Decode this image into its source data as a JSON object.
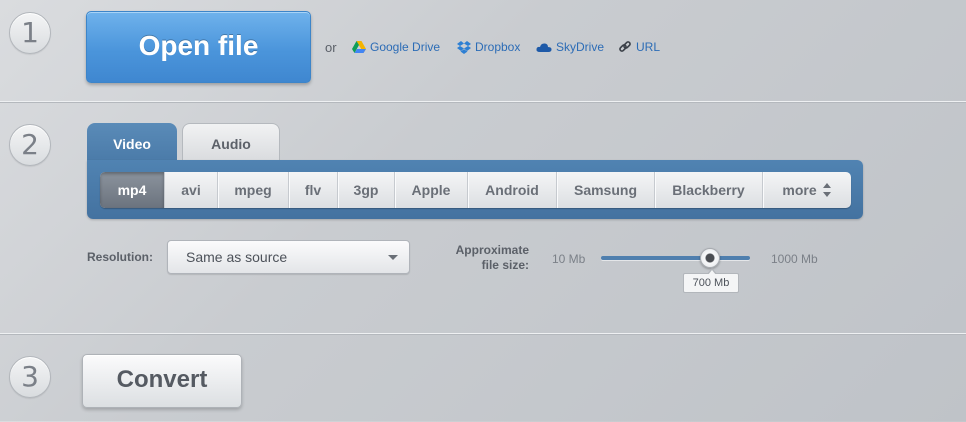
{
  "steps": [
    "1",
    "2",
    "3"
  ],
  "open_file": {
    "label": "Open file",
    "or_text": "or"
  },
  "sources": [
    {
      "label": "Google Drive",
      "icon": "google-drive-icon"
    },
    {
      "label": "Dropbox",
      "icon": "dropbox-icon"
    },
    {
      "label": "SkyDrive",
      "icon": "skydrive-icon"
    },
    {
      "label": "URL",
      "icon": "link-icon"
    }
  ],
  "tabs": {
    "video": "Video",
    "audio": "Audio",
    "active": "video"
  },
  "formats": {
    "items": [
      "mp4",
      "avi",
      "mpeg",
      "flv",
      "3gp",
      "Apple",
      "Android",
      "Samsung",
      "Blackberry",
      "more"
    ],
    "selected": "mp4"
  },
  "resolution": {
    "label": "Resolution:",
    "value": "Same as source"
  },
  "file_size": {
    "label_line1": "Approximate",
    "label_line2": "file size:",
    "min": "10 Mb",
    "max": "1000 Mb",
    "value": "700 Mb"
  },
  "convert": {
    "label": "Convert"
  },
  "colors": {
    "primary_blue": "#4b95db",
    "panel_blue": "#4a7aa8",
    "link_blue": "#2c6cb6"
  }
}
